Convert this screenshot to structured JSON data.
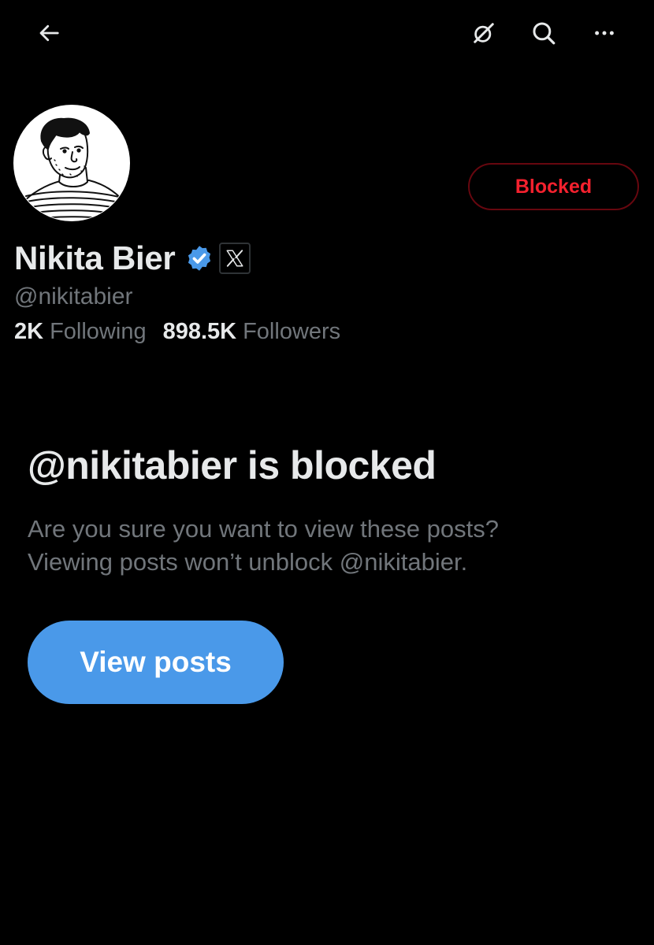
{
  "header": {
    "back_icon": "arrow-left-icon",
    "grok_icon": "grok-icon",
    "search_icon": "search-icon",
    "more_icon": "more-horizontal-icon"
  },
  "profile": {
    "display_name": "Nikita Bier",
    "handle": "@nikitabier",
    "verified_icon": "verified-badge-icon",
    "affiliation_icon": "x-logo-icon",
    "following_count": "2K",
    "following_label": "Following",
    "followers_count": "898.5K",
    "followers_label": "Followers",
    "block_button_label": "Blocked"
  },
  "blocked_notice": {
    "title": "@nikitabier is blocked",
    "line1": "Are you sure you want to view these posts?",
    "line2": "Viewing posts won’t unblock @nikitabier.",
    "button_label": "View posts"
  },
  "colors": {
    "background": "#000000",
    "primary_text": "#e7e9ea",
    "secondary_text": "#71767b",
    "blocked_red": "#f4212e",
    "accent_blue": "#4a99e9"
  }
}
